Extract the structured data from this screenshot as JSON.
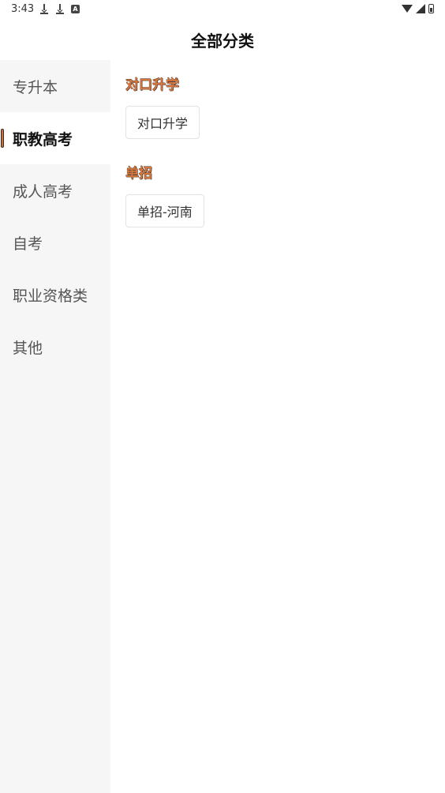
{
  "status_bar": {
    "time": "3:43",
    "left_icons": [
      "download-icon",
      "download-icon",
      "a-box-icon"
    ],
    "right_icons": [
      "wifi-icon",
      "signal-icon",
      "battery-icon"
    ]
  },
  "header": {
    "title": "全部分类"
  },
  "sidebar": {
    "items": [
      {
        "label": "专升本"
      },
      {
        "label": "职教高考"
      },
      {
        "label": "成人高考"
      },
      {
        "label": "自考"
      },
      {
        "label": "职业资格类"
      },
      {
        "label": "其他"
      }
    ],
    "selected_index": 1
  },
  "content": {
    "sections": [
      {
        "title": "对口升学",
        "tags": [
          "对口升学"
        ]
      },
      {
        "title": "单招",
        "tags": [
          "单招-河南"
        ]
      }
    ]
  },
  "colors": {
    "accent": "#d9783e",
    "sidebar_bg": "#f6f6f6",
    "selected_bg": "#ffffff"
  }
}
